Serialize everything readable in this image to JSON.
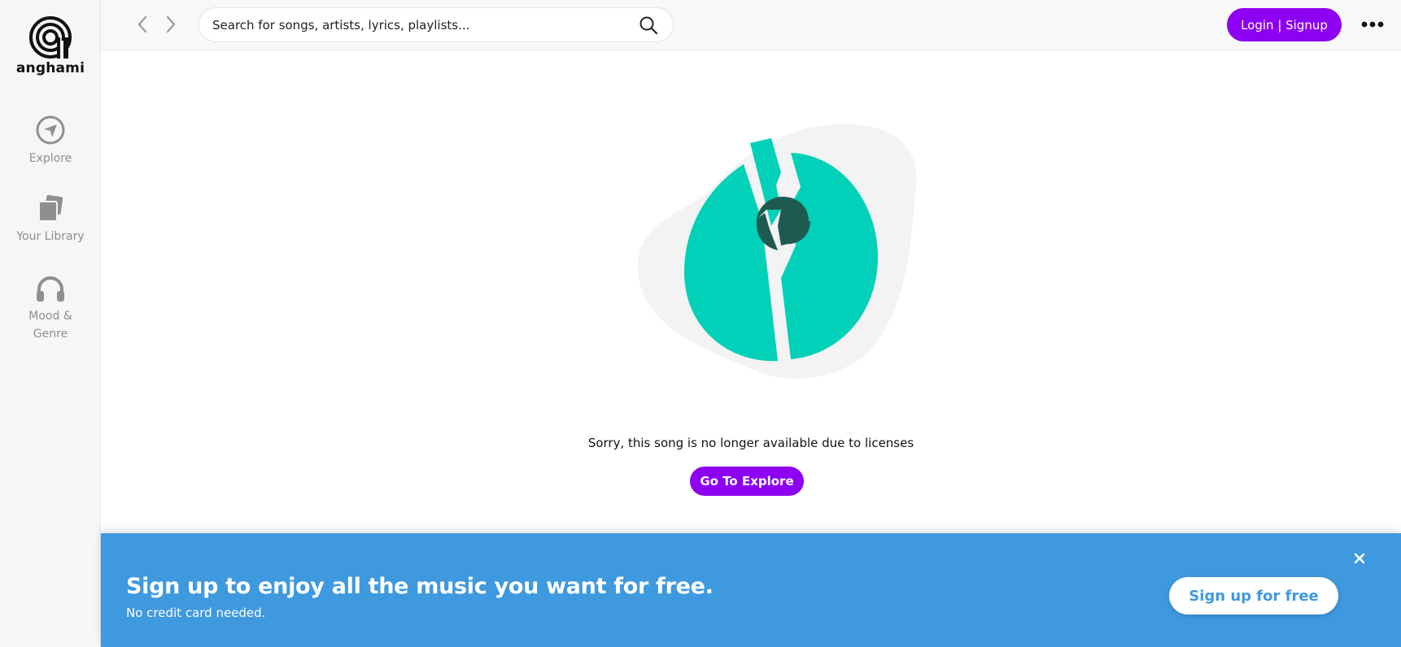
{
  "sidebar": {
    "logo_text": "anghami",
    "items": [
      {
        "label": "Explore",
        "icon": "explore-icon"
      },
      {
        "label": "Your Library",
        "icon": "library-icon"
      },
      {
        "label": "Mood &",
        "label2": "Genre",
        "icon": "headphones-icon"
      }
    ]
  },
  "header": {
    "search_placeholder": "Search for songs, artists, lyrics, playlists...",
    "login_label": "Login | Signup"
  },
  "main": {
    "message": "Sorry, this song is no longer available due to licenses",
    "explore_button": "Go To Explore"
  },
  "banner": {
    "title": "Sign up to enjoy all the music you want for free.",
    "subtitle": "No credit card needed.",
    "signup_button": "Sign up for free"
  },
  "colors": {
    "accent": "#8d00f2",
    "banner": "#3f99de",
    "disc": "#00d1b8",
    "disc_center": "#1f5a52",
    "blob": "#f3f3f3"
  }
}
